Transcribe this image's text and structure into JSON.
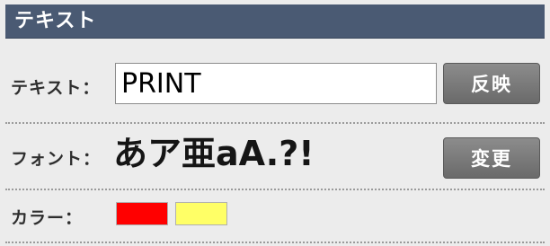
{
  "section": {
    "title": "テキスト"
  },
  "text_row": {
    "label": "テキスト：",
    "input_value": "PRINT",
    "apply_label": "反映"
  },
  "font_row": {
    "label": "フォント：",
    "preview": "あア亜aA.?!",
    "change_label": "変更"
  },
  "color_row": {
    "label": "カラー：",
    "colors": {
      "fill": "#ff0000",
      "outline": "#ffff66"
    }
  }
}
